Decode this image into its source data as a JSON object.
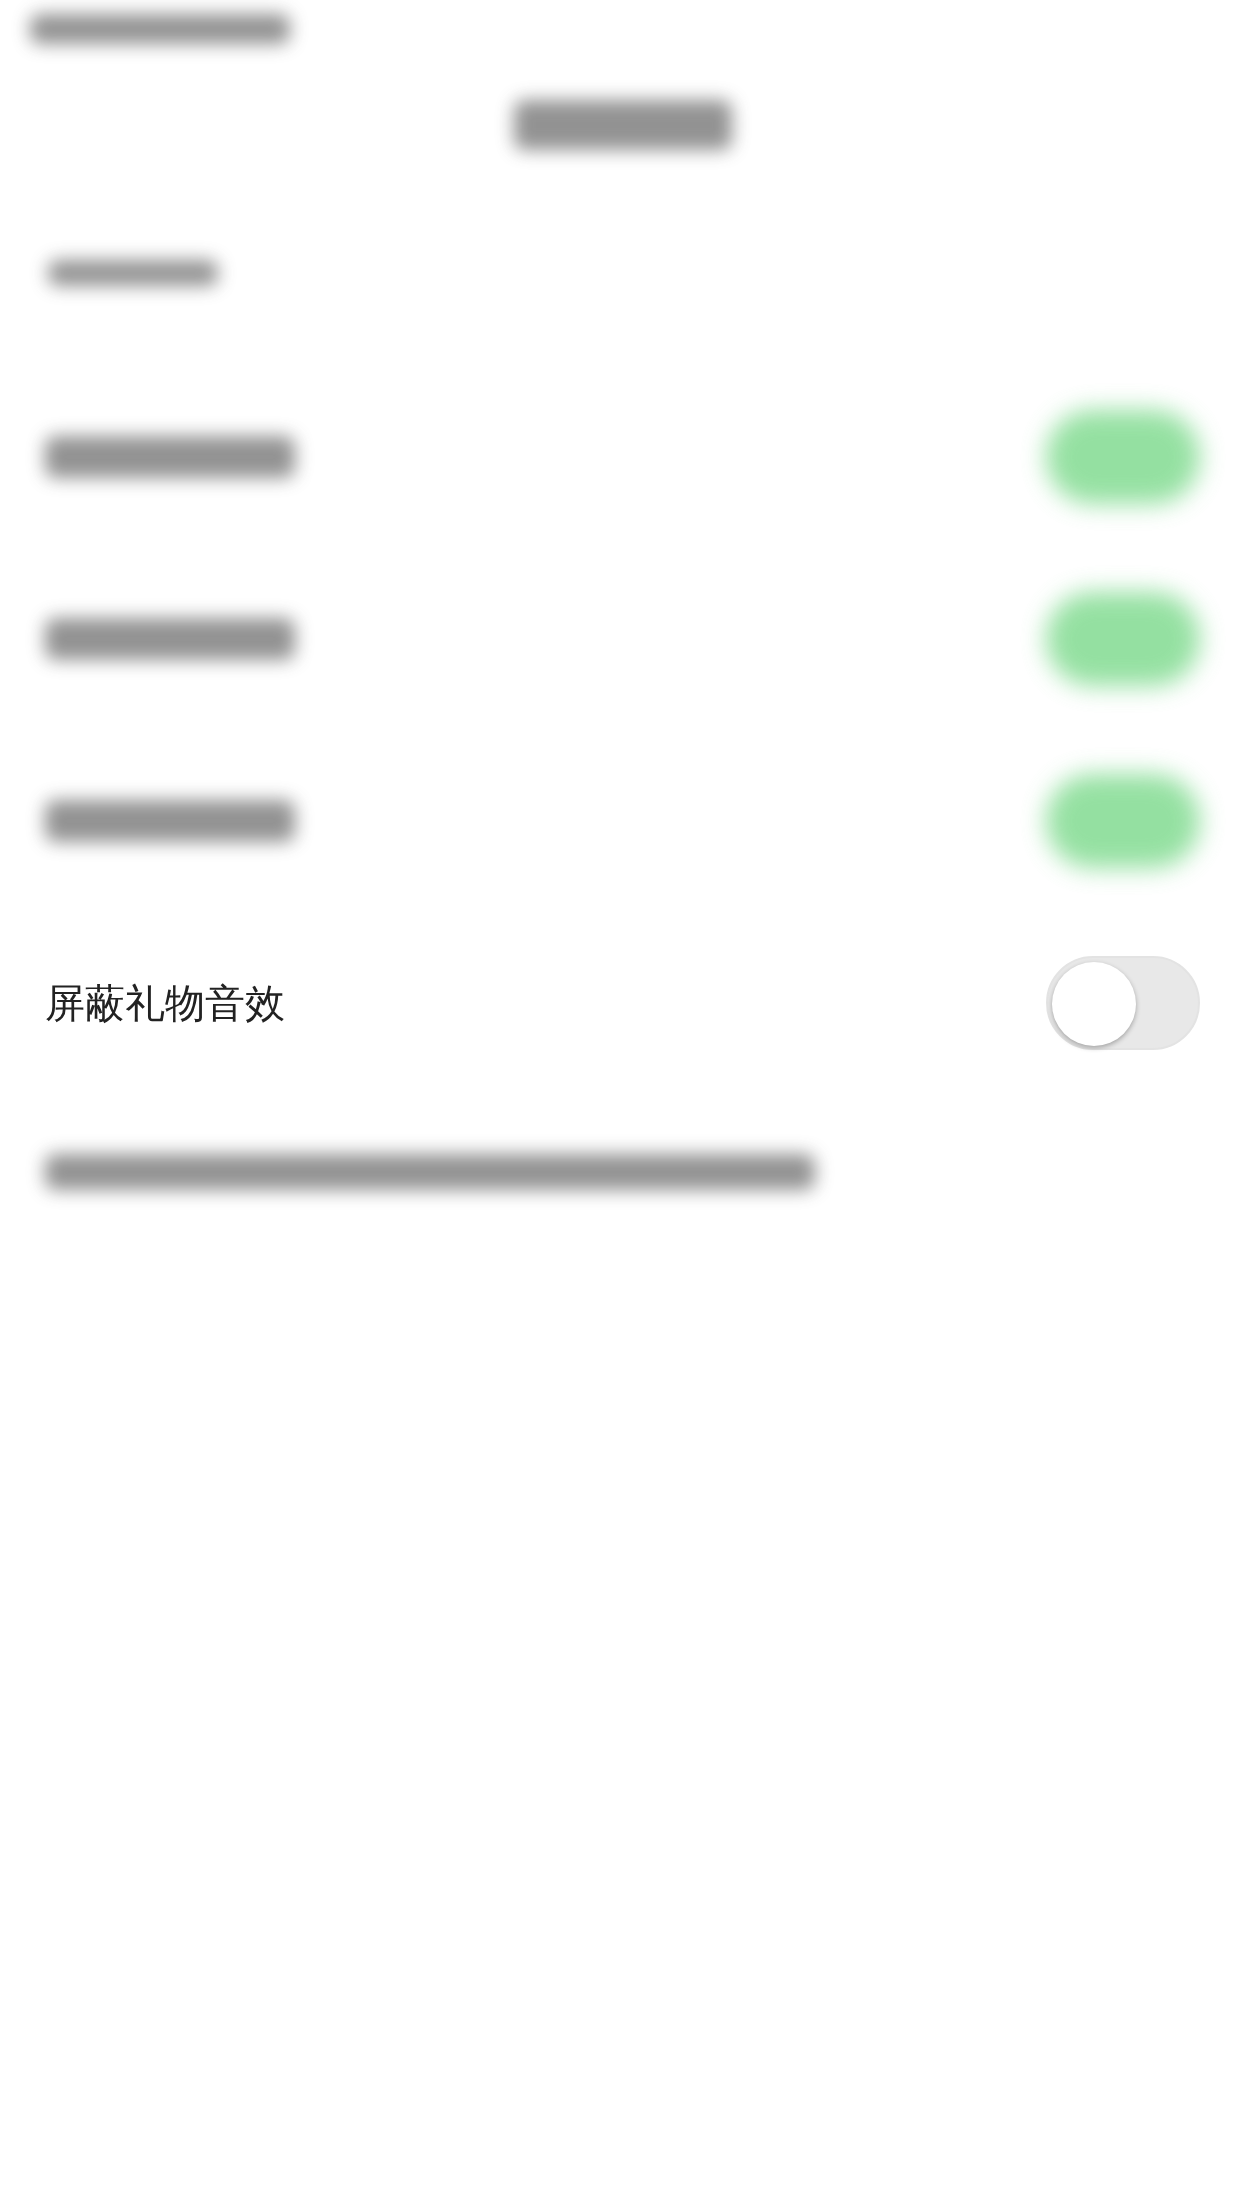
{
  "settings": [
    {
      "kind": "blurred",
      "on": true
    },
    {
      "kind": "blurred",
      "on": true
    },
    {
      "kind": "blurred",
      "on": true
    },
    {
      "kind": "labeled",
      "label": "屏蔽礼物音效",
      "on": false
    }
  ]
}
